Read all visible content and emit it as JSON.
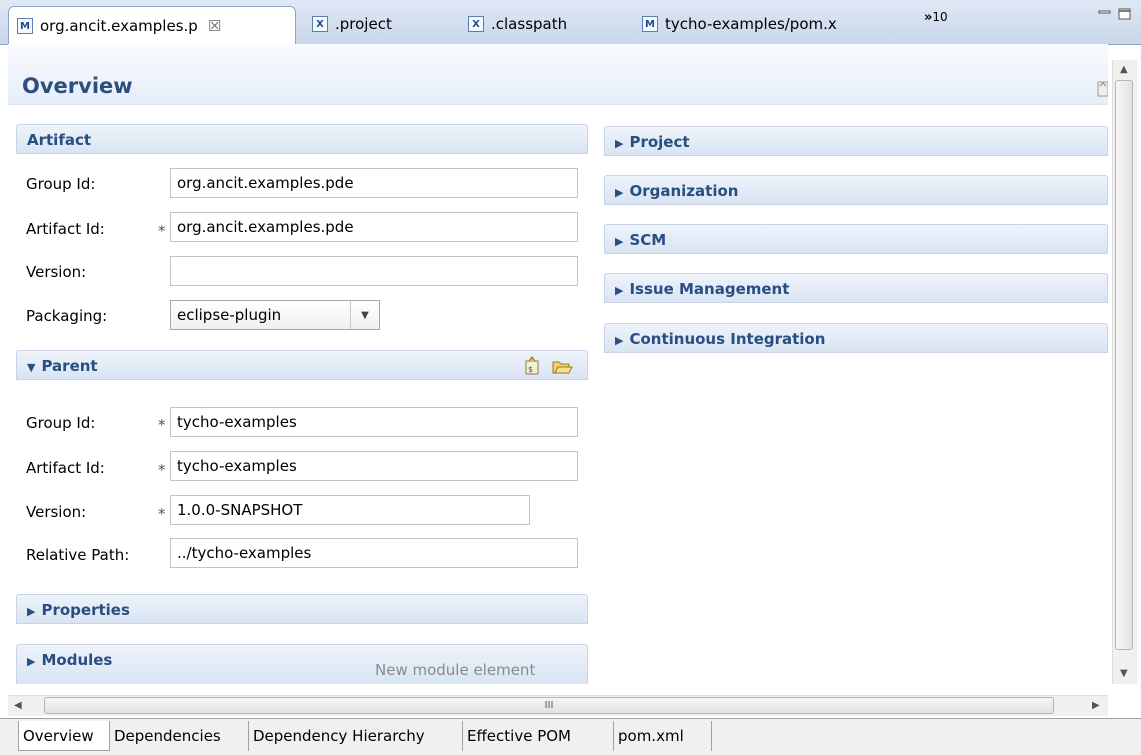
{
  "editor_tabs": [
    {
      "label": "org.ancit.examples.p",
      "icon": "maven-file-icon",
      "glyph": "M",
      "active": true
    },
    {
      "label": ".project",
      "icon": "xml-file-icon",
      "glyph": "X"
    },
    {
      "label": ".classpath",
      "icon": "xml-file-icon",
      "glyph": "X"
    },
    {
      "label": "tycho-examples/pom.x",
      "icon": "maven-file-icon",
      "glyph": "M"
    }
  ],
  "tab_close_glyph": "☒",
  "overflow": {
    "glyph": "»",
    "count": "10"
  },
  "header": {
    "title": "Overview"
  },
  "artifact": {
    "title": "Artifact",
    "group_id_label": "Group Id:",
    "group_id": "org.ancit.examples.pde",
    "artifact_id_label": "Artifact Id:",
    "artifact_id": "org.ancit.examples.pde",
    "version_label": "Version:",
    "version": "",
    "packaging_label": "Packaging:",
    "packaging": "eclipse-plugin"
  },
  "parent": {
    "title": "Parent",
    "group_id_label": "Group Id:",
    "group_id": "tycho-examples",
    "artifact_id_label": "Artifact Id:",
    "artifact_id": "tycho-examples",
    "version_label": "Version:",
    "version": "1.0.0-SNAPSHOT",
    "relative_path_label": "Relative Path:",
    "relative_path": "../tycho-examples"
  },
  "required_marker": "*",
  "properties": {
    "title": "Properties"
  },
  "modules": {
    "title": "Modules",
    "hint": "New module element"
  },
  "right_sections": [
    "Project",
    "Organization",
    "SCM",
    "Issue Management",
    "Continuous Integration"
  ],
  "hscroll_grip": "III",
  "bottom_tabs": [
    "Overview",
    "Dependencies",
    "Dependency Hierarchy",
    "Effective POM",
    "pom.xml"
  ]
}
